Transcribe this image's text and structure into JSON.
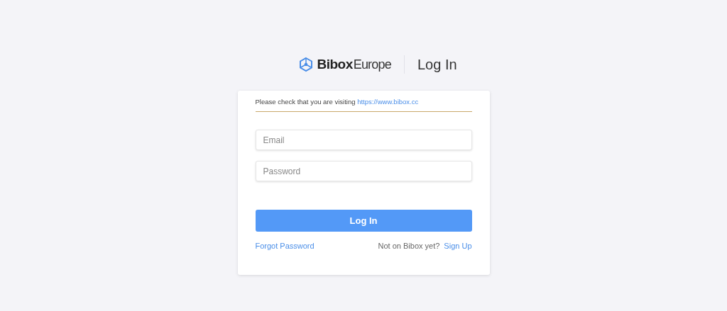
{
  "header": {
    "brand": {
      "bold": "Bibox",
      "light": "Europe"
    },
    "title": "Log In"
  },
  "notice": {
    "text": "Please check that you are visiting ",
    "link": "https://www.bibox.cc"
  },
  "fields": [
    {
      "placeholder": "Email"
    },
    {
      "placeholder": "Password"
    }
  ],
  "submit": "Log In",
  "footer": {
    "forgot": "Forgot Password",
    "prompt": "Not on Bibox yet?",
    "signup": "Sign Up"
  }
}
